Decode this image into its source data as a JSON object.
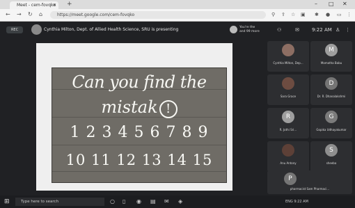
{
  "browser": {
    "tab_title": "Meet - cem-fovqko",
    "new_tab": "+",
    "address": "https://meet.google.com/cem-fovqko",
    "window_controls": [
      "–",
      "□",
      "✕"
    ]
  },
  "meet": {
    "rec_label": "REC",
    "presenting_text": "Cynthia Milton, Dept. of Allied Health Science, SRU is presenting",
    "you_presenting_line1": "You're the",
    "you_presenting_line2": "and 99 more",
    "time": "9:22 AM"
  },
  "slide": {
    "line1": "Can you find the",
    "line2": "mistak",
    "line2_mark": "!",
    "line3": "1 2 3 4 5 6 7 8 9",
    "line4": "10 11 12 13 14 15"
  },
  "participants": [
    {
      "initial": "",
      "name": "Cynthia Milton, Dep...",
      "color": "#8d6e63"
    },
    {
      "initial": "M",
      "name": "Mamatha Babu",
      "color": "#9e9e9e"
    },
    {
      "initial": "",
      "name": "Sara Grace",
      "color": "#6d4c41"
    },
    {
      "initial": "D",
      "name": "Dr. R. Dhanalakshmi",
      "color": "#757575"
    },
    {
      "initial": "R",
      "name": "R. Jothi Sri...",
      "color": "#9e9e9e"
    },
    {
      "initial": "G",
      "name": "Gopika Udhayakumar",
      "color": "#7b7b7b"
    },
    {
      "initial": "",
      "name": "Anu Antony",
      "color": "#5d4037"
    },
    {
      "initial": "S",
      "name": "sheeba",
      "color": "#8e8e8e"
    },
    {
      "initial": "P",
      "name": "pharmacist Sam Pharmaci...",
      "color": "#757575"
    }
  ],
  "taskbar": {
    "search_placeholder": "Type here to search",
    "tray_text": "ENG 9:22 AM"
  }
}
